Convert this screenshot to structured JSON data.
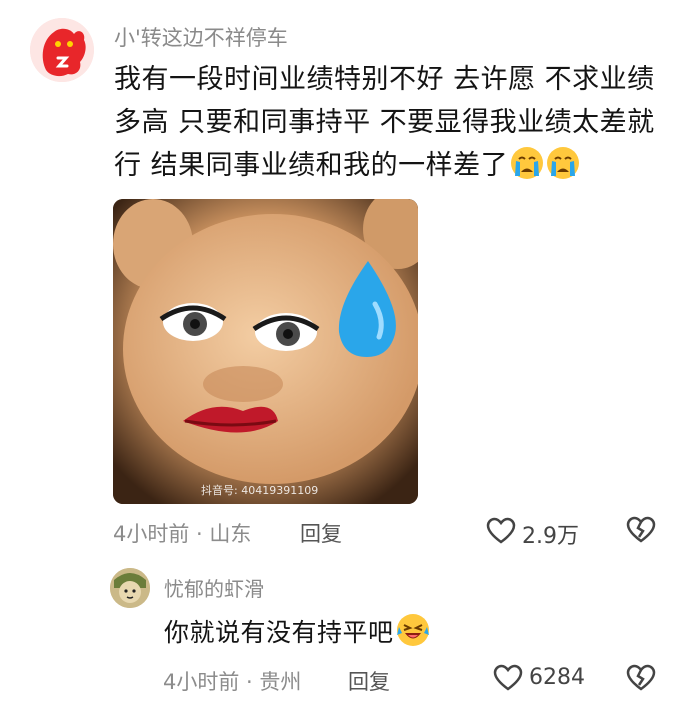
{
  "comment": {
    "username": "小'转这边不祥停车",
    "text": "我有一段时间业绩特别不好 去许愿 不求业绩多高 只要和同事持平 不要显得我业绩太差就行 结果同事业绩和我的一样差了",
    "emoji": [
      "crying-emoji",
      "crying-emoji"
    ],
    "image_watermark": "抖音号: 40419391109",
    "time_location": "4小时前 · 山东",
    "reply_label": "回复",
    "like_count": "2.9万"
  },
  "reply": {
    "username": "忧郁的虾滑",
    "text": "你就说有没有持平吧",
    "emoji": "laughing-crying-emoji",
    "time_location": "4小时前 · 贵州",
    "reply_label": "回复",
    "like_count": "6284"
  },
  "colors": {
    "meta_gray": "#8c8c8c",
    "avatar_red": "#e8262a",
    "emoji_yellow": "#ffc83d",
    "tear_blue": "#2aa6ea"
  }
}
